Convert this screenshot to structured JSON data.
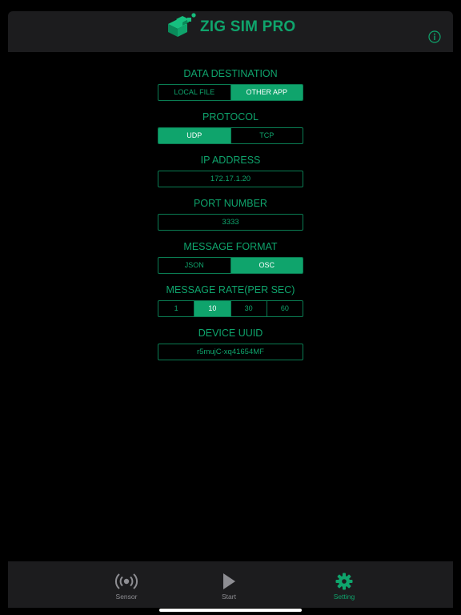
{
  "header": {
    "title": "ZIG SIM PRO",
    "logo_icon": "stacked-cubes-logo",
    "info_icon": "info-circle-icon"
  },
  "colors": {
    "accent": "#0fa46c",
    "bar_background": "#1c1c1e",
    "background": "#000000",
    "inactive": "#8e8e93"
  },
  "settings": {
    "data_destination": {
      "label": "DATA DESTINATION",
      "options": [
        "LOCAL FILE",
        "OTHER APP"
      ],
      "selected": "OTHER APP"
    },
    "protocol": {
      "label": "PROTOCOL",
      "options": [
        "UDP",
        "TCP"
      ],
      "selected": "UDP"
    },
    "ip_address": {
      "label": "IP ADDRESS",
      "value": "172.17.1.20"
    },
    "port_number": {
      "label": "PORT NUMBER",
      "value": "3333"
    },
    "message_format": {
      "label": "MESSAGE FORMAT",
      "options": [
        "JSON",
        "OSC"
      ],
      "selected": "OSC"
    },
    "message_rate": {
      "label": "MESSAGE RATE(PER SEC)",
      "options": [
        "1",
        "10",
        "30",
        "60"
      ],
      "selected": "10"
    },
    "device_uuid": {
      "label": "DEVICE UUID",
      "value": "r5mujC-xq41654MF"
    }
  },
  "tabbar": {
    "tabs": [
      {
        "label": "Sensor",
        "icon": "broadcast-icon"
      },
      {
        "label": "Start",
        "icon": "play-icon"
      },
      {
        "label": "Setting",
        "icon": "gear-icon"
      }
    ],
    "active": "Setting"
  }
}
